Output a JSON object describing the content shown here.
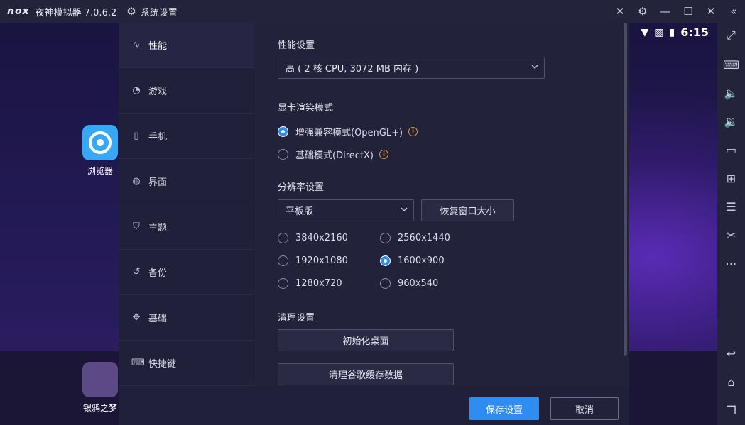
{
  "titlebar": {
    "logo": "nox",
    "app_title": "夜神模拟器 7.0.6.2",
    "settings_title": "系统设置"
  },
  "status_bar": {
    "time": "6:15"
  },
  "desktop_apps": [
    {
      "label": "浏览器",
      "color": "#36a8f5"
    },
    {
      "label": "银鸦之梦",
      "color": "#5b4a86"
    }
  ],
  "nav": {
    "items": [
      {
        "label": "性能",
        "icon": "pulse-icon",
        "active": true
      },
      {
        "label": "游戏",
        "icon": "gauge-icon"
      },
      {
        "label": "手机",
        "icon": "phone-icon"
      },
      {
        "label": "界面",
        "icon": "palette-icon"
      },
      {
        "label": "主题",
        "icon": "shirt-icon"
      },
      {
        "label": "备份",
        "icon": "history-icon"
      },
      {
        "label": "基础",
        "icon": "puzzle-icon"
      },
      {
        "label": "快捷键",
        "icon": "keyboard-icon"
      }
    ]
  },
  "performance": {
    "title": "性能设置",
    "selected": "高 ( 2 核 CPU, 3072 MB 内存 )"
  },
  "render": {
    "title": "显卡渲染模式",
    "options": [
      {
        "label": "增强兼容模式(OpenGL+)",
        "selected": true
      },
      {
        "label": "基础模式(DirectX)",
        "selected": false
      }
    ]
  },
  "resolution": {
    "title": "分辨率设置",
    "mode": "平板版",
    "restore_label": "恢复窗口大小",
    "options": [
      {
        "label": "3840x2160",
        "selected": false
      },
      {
        "label": "2560x1440",
        "selected": false
      },
      {
        "label": "1920x1080",
        "selected": false
      },
      {
        "label": "1600x900",
        "selected": true
      },
      {
        "label": "1280x720",
        "selected": false
      },
      {
        "label": "960x540",
        "selected": false
      }
    ]
  },
  "cleanup": {
    "title": "清理设置",
    "init_desktop_label": "初始化桌面",
    "clear_cache_label": "清理谷歌缓存数据"
  },
  "footer": {
    "save_label": "保存设置",
    "cancel_label": "取消"
  },
  "colors": {
    "accent": "#2f8cf0",
    "dialog_bg": "#22223a",
    "info": "#d29a3a"
  }
}
